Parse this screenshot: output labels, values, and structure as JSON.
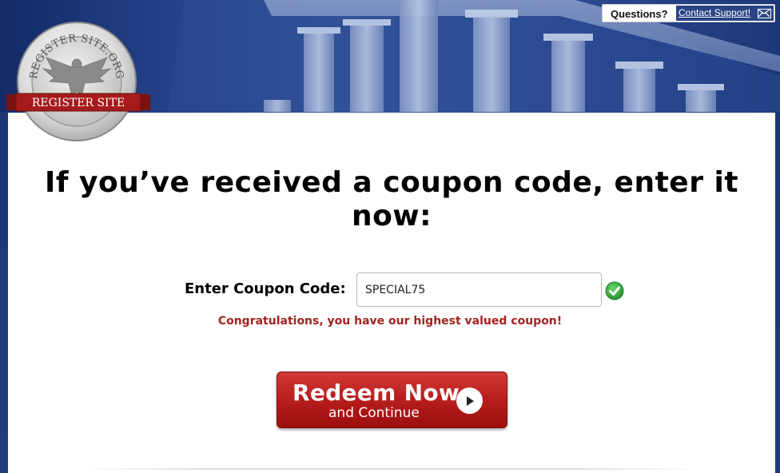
{
  "header": {
    "logo_text_top": "REGISTER SITE.ORG",
    "logo_banner": "REGISTER SITE"
  },
  "support": {
    "question": "Questions?",
    "contact_link": "Contact Support!"
  },
  "main": {
    "heading": "If you’ve received a coupon code, enter it now:",
    "coupon_label": "Enter Coupon Code:",
    "coupon_value": "SPECIAL75",
    "coupon_status": "valid",
    "message": "Congratulations, you have our highest valued coupon!",
    "redeem_main": "Redeem Now",
    "redeem_sub": "and Continue"
  },
  "colors": {
    "brand_blue": "#1e3778",
    "button_red": "#b71d1d",
    "message_red": "#a2231f",
    "check_green": "#2fa33a"
  },
  "icons": [
    "envelope-icon",
    "checkmark-icon",
    "play-icon",
    "eagle-seal-icon"
  ]
}
